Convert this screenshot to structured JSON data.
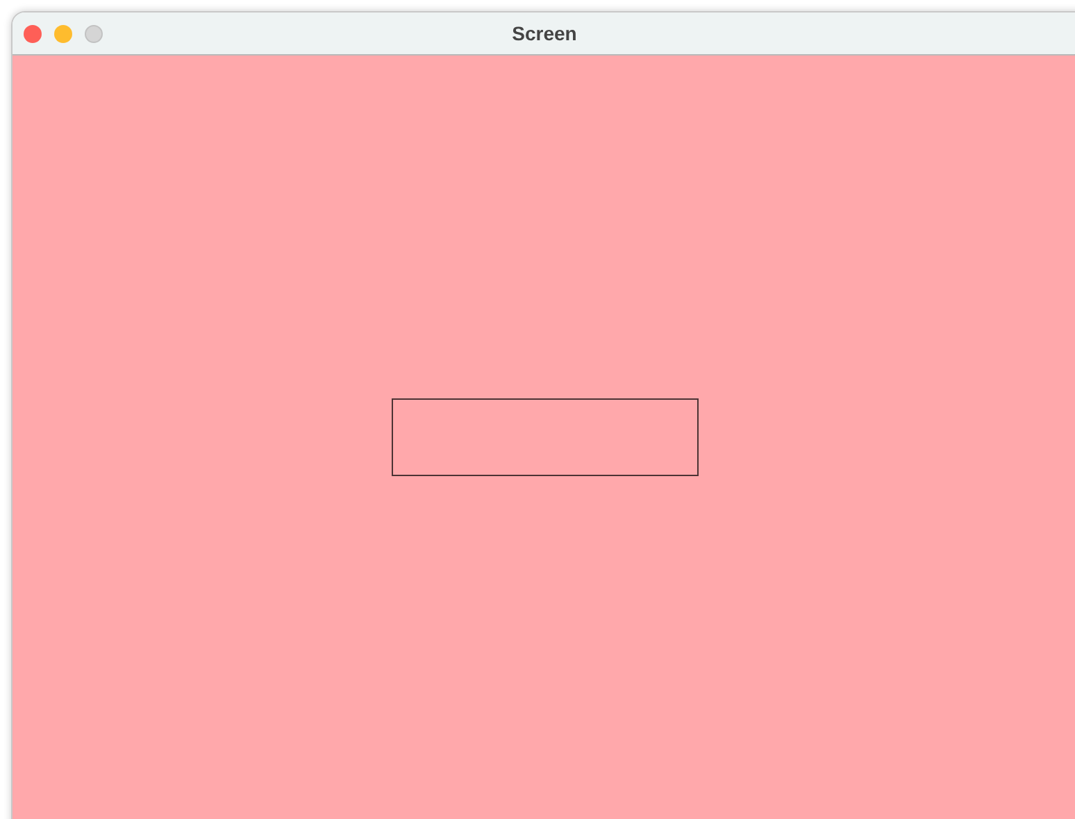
{
  "window": {
    "title": "Screen"
  },
  "window_controls": [
    {
      "kind": "close",
      "disabled": false
    },
    {
      "kind": "minimize",
      "disabled": false
    },
    {
      "kind": "zoom",
      "disabled": true
    }
  ],
  "field": {
    "kind": "text"
  }
}
